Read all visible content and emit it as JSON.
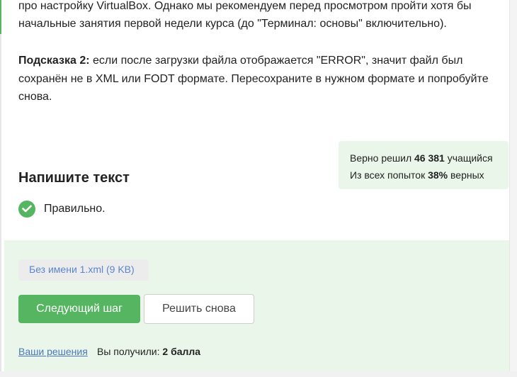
{
  "content": {
    "para1_line1": "про настройку VirtualBox. Однако мы рекомендуем перед просмотром пройти хотя бы",
    "para1_line2": "начальные занятия первой недели курса (до \"Терминал: основы\" включительно).",
    "hint2_label": "Подсказка 2:",
    "hint2_text": " если после загрузки файла отображается \"ERROR\", значит файл был сохранён не в XML или FODT формате. Пересохраните в нужном формате и попробуйте снова."
  },
  "stats": {
    "solved_prefix": "Верно решил",
    "solved_count": "46 381",
    "solved_suffix": "учащийся",
    "attempts_prefix": "Из всех попыток",
    "attempts_percent": "38%",
    "attempts_suffix": "верных"
  },
  "task": {
    "title": "Напишите текст",
    "status": "Правильно."
  },
  "result": {
    "file_name": "Без имени 1.xml (9 KB)",
    "next_button": "Следующий шаг",
    "retry_button": "Решить снова",
    "solutions_link": "Ваши решения",
    "score_prefix": "Вы получили:",
    "score_value": "2 балла"
  },
  "colors": {
    "accent_green": "#55b561",
    "panel_green": "#e9f6e9",
    "link_blue": "#4a78bd"
  }
}
